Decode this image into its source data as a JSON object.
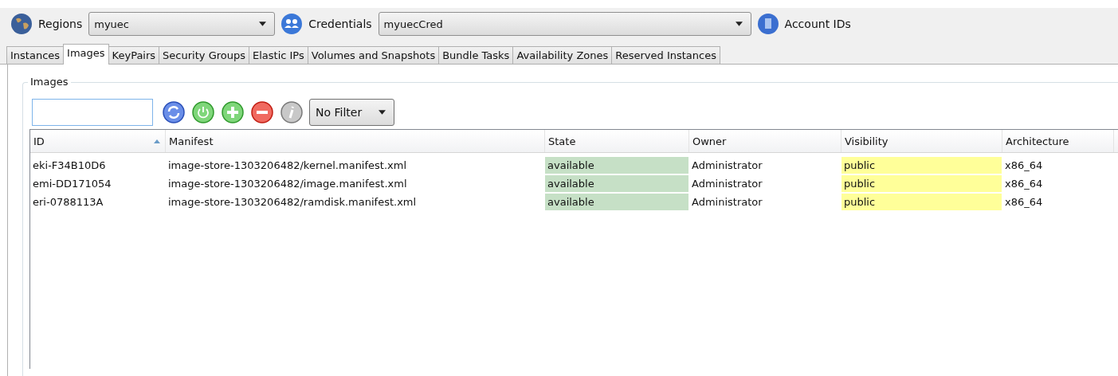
{
  "toolbar": {
    "regions": {
      "label": "Regions",
      "value": "myuec"
    },
    "credentials": {
      "label": "Credentials",
      "value": "myuecCred"
    },
    "account_ids": {
      "label": "Account IDs"
    }
  },
  "tabs": [
    {
      "label": "Instances",
      "selected": false
    },
    {
      "label": "Images",
      "selected": true
    },
    {
      "label": "KeyPairs",
      "selected": false
    },
    {
      "label": "Security Groups",
      "selected": false
    },
    {
      "label": "Elastic IPs",
      "selected": false
    },
    {
      "label": "Volumes and Snapshots",
      "selected": false
    },
    {
      "label": "Bundle Tasks",
      "selected": false
    },
    {
      "label": "Availability Zones",
      "selected": false
    },
    {
      "label": "Reserved Instances",
      "selected": false
    }
  ],
  "group": {
    "title": "Images",
    "filter": "No Filter",
    "actions": [
      {
        "kind": "refresh"
      },
      {
        "kind": "power"
      },
      {
        "kind": "add"
      },
      {
        "kind": "remove"
      },
      {
        "kind": "info"
      }
    ],
    "table": {
      "columns": [
        {
          "label": "ID",
          "sorted": true
        },
        {
          "label": "Manifest",
          "sorted": false
        },
        {
          "label": "State",
          "sorted": false
        },
        {
          "label": "Owner",
          "sorted": false
        },
        {
          "label": "Visibility",
          "sorted": false
        },
        {
          "label": "Architecture",
          "sorted": false
        }
      ],
      "rows": [
        {
          "id": "eki-F34B10D6",
          "manifest": "image-store-1303206482/kernel.manifest.xml",
          "state": {
            "text": "available",
            "color": "#c6e0c6"
          },
          "owner": "Administrator",
          "visibility": {
            "text": "public",
            "color": "#ffff99"
          },
          "architecture": "x86_64"
        },
        {
          "id": "emi-DD171054",
          "manifest": "image-store-1303206482/image.manifest.xml",
          "state": {
            "text": "available",
            "color": "#c6e0c6"
          },
          "owner": "Administrator",
          "visibility": {
            "text": "public",
            "color": "#ffff99"
          },
          "architecture": "x86_64"
        },
        {
          "id": "eri-0788113A",
          "manifest": "image-store-1303206482/ramdisk.manifest.xml",
          "state": {
            "text": "available",
            "color": "#c6e0c6"
          },
          "owner": "Administrator",
          "visibility": {
            "text": "public",
            "color": "#ffff99"
          },
          "architecture": "x86_64"
        }
      ]
    }
  }
}
